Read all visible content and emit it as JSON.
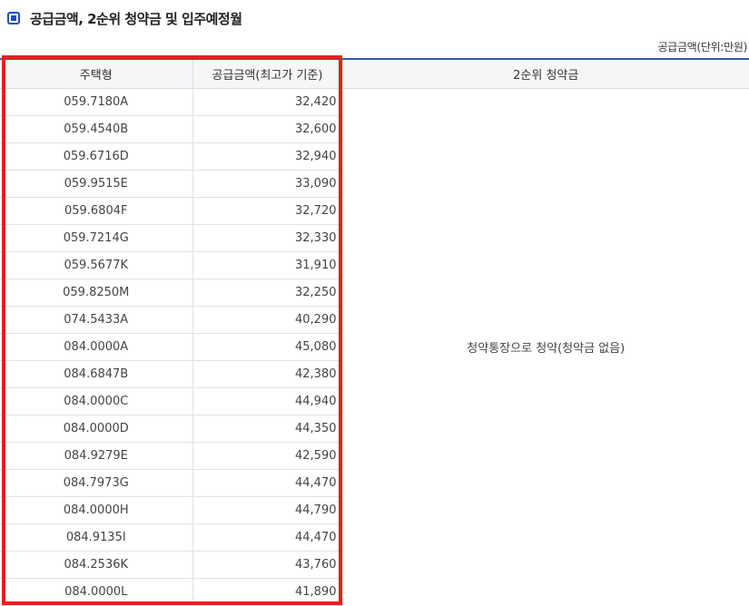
{
  "section": {
    "title": "공급금액, 2순위 청약금 및 입주예정월",
    "unit_note": "공급금액(단위:만원)"
  },
  "table": {
    "headers": {
      "type": "주택형",
      "price": "공급금액(최고가 기준)",
      "second_priority": "2순위 청약금"
    },
    "second_priority_note": "청약통장으로 청약(청약금 없음)",
    "rows": [
      {
        "type": "059.7180A",
        "price": "32,420"
      },
      {
        "type": "059.4540B",
        "price": "32,600"
      },
      {
        "type": "059.6716D",
        "price": "32,940"
      },
      {
        "type": "059.9515E",
        "price": "33,090"
      },
      {
        "type": "059.6804F",
        "price": "32,720"
      },
      {
        "type": "059.7214G",
        "price": "32,330"
      },
      {
        "type": "059.5677K",
        "price": "31,910"
      },
      {
        "type": "059.8250M",
        "price": "32,250"
      },
      {
        "type": "074.5433A",
        "price": "40,290"
      },
      {
        "type": "084.0000A",
        "price": "45,080"
      },
      {
        "type": "084.6847B",
        "price": "42,380"
      },
      {
        "type": "084.0000C",
        "price": "44,940"
      },
      {
        "type": "084.0000D",
        "price": "44,350"
      },
      {
        "type": "084.9279E",
        "price": "42,590"
      },
      {
        "type": "084.7973G",
        "price": "44,470"
      },
      {
        "type": "084.0000H",
        "price": "44,790"
      },
      {
        "type": "084.9135I",
        "price": "44,470"
      },
      {
        "type": "084.2536K",
        "price": "43,760"
      },
      {
        "type": "084.0000L",
        "price": "41,890"
      }
    ]
  },
  "colors": {
    "accent": "#1b4fb8",
    "header_rule": "#2e5ca8",
    "highlight": "#e2231a"
  },
  "icons": {
    "title_bullet": "square-bullet-icon"
  }
}
